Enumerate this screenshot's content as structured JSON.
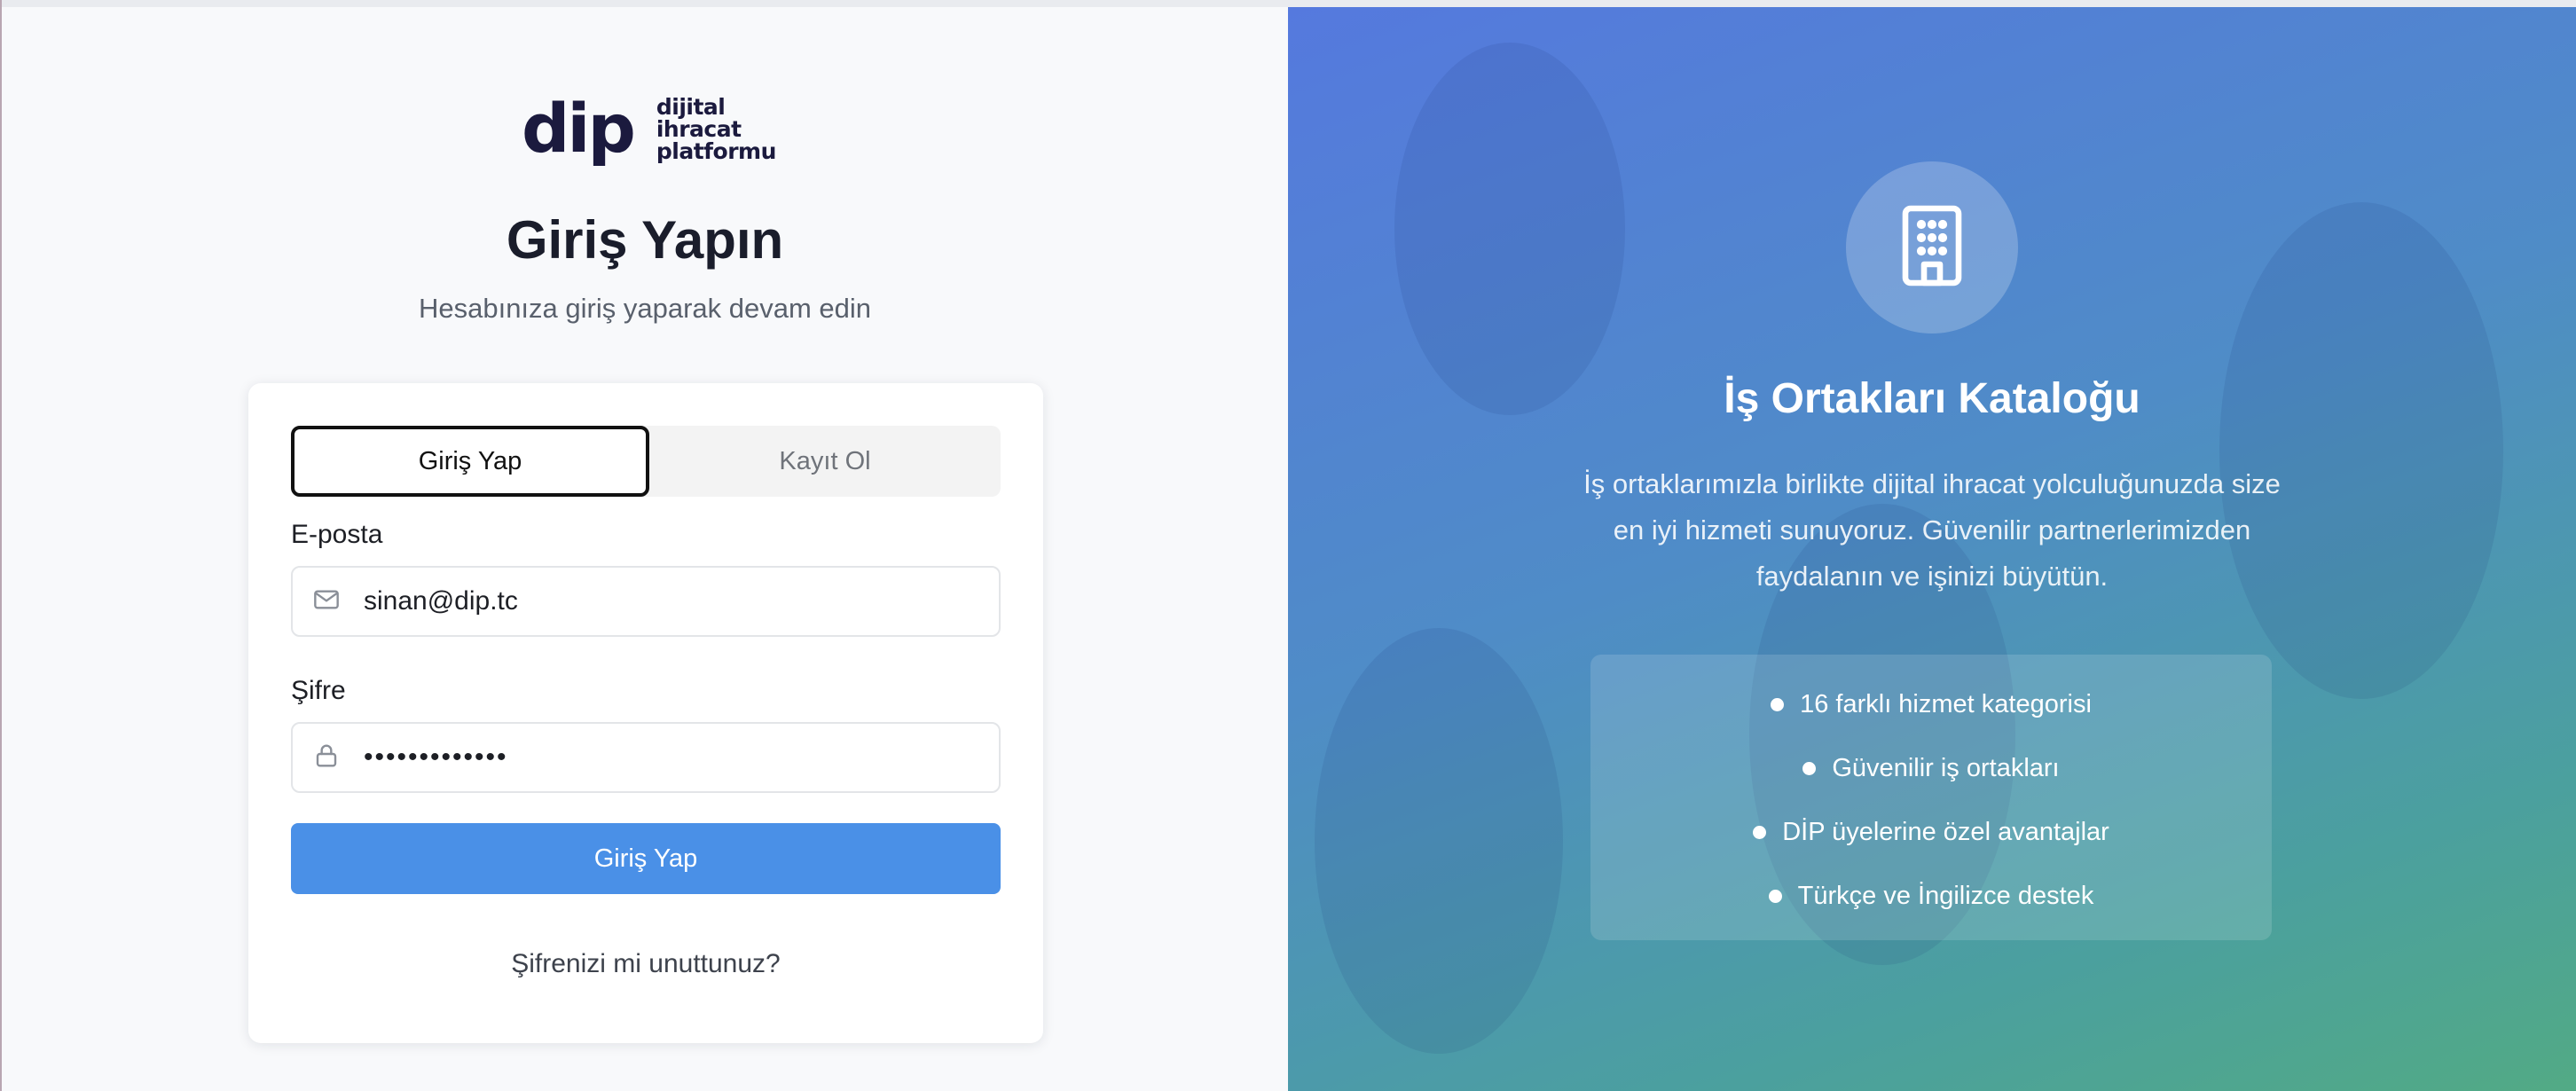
{
  "logo": {
    "mark": "dip",
    "lines": [
      "dijital",
      "ihracat",
      "platformu"
    ]
  },
  "header": {
    "title": "Giriş Yapın",
    "subtitle": "Hesabınıza giriş yaparak devam edin"
  },
  "tabs": {
    "login": "Giriş Yap",
    "register": "Kayıt Ol"
  },
  "form": {
    "email_label": "E-posta",
    "email_value": "sinan@dip.tc",
    "password_label": "Şifre",
    "password_value": "•••••••••••••",
    "submit_label": "Giriş Yap",
    "forgot_label": "Şifrenizi mi unuttunuz?"
  },
  "promo": {
    "icon": "building-icon",
    "title": "İş Ortakları Kataloğu",
    "description": "İş ortaklarımızla birlikte dijital ihracat yolculuğunuzda size en iyi hizmeti sunuyoruz. Güvenilir partnerlerimizden faydalanın ve işinizi büyütün.",
    "features": [
      "16 farklı hizmet kategorisi",
      "Güvenilir iş ortakları",
      "DİP üyelerine özel avantajlar",
      "Türkçe ve İngilizce destek"
    ]
  },
  "colors": {
    "primary_button": "#4a90e7",
    "brand_dark": "#1b1a3e",
    "gradient_start": "#5579de",
    "gradient_end": "#52aa85"
  }
}
